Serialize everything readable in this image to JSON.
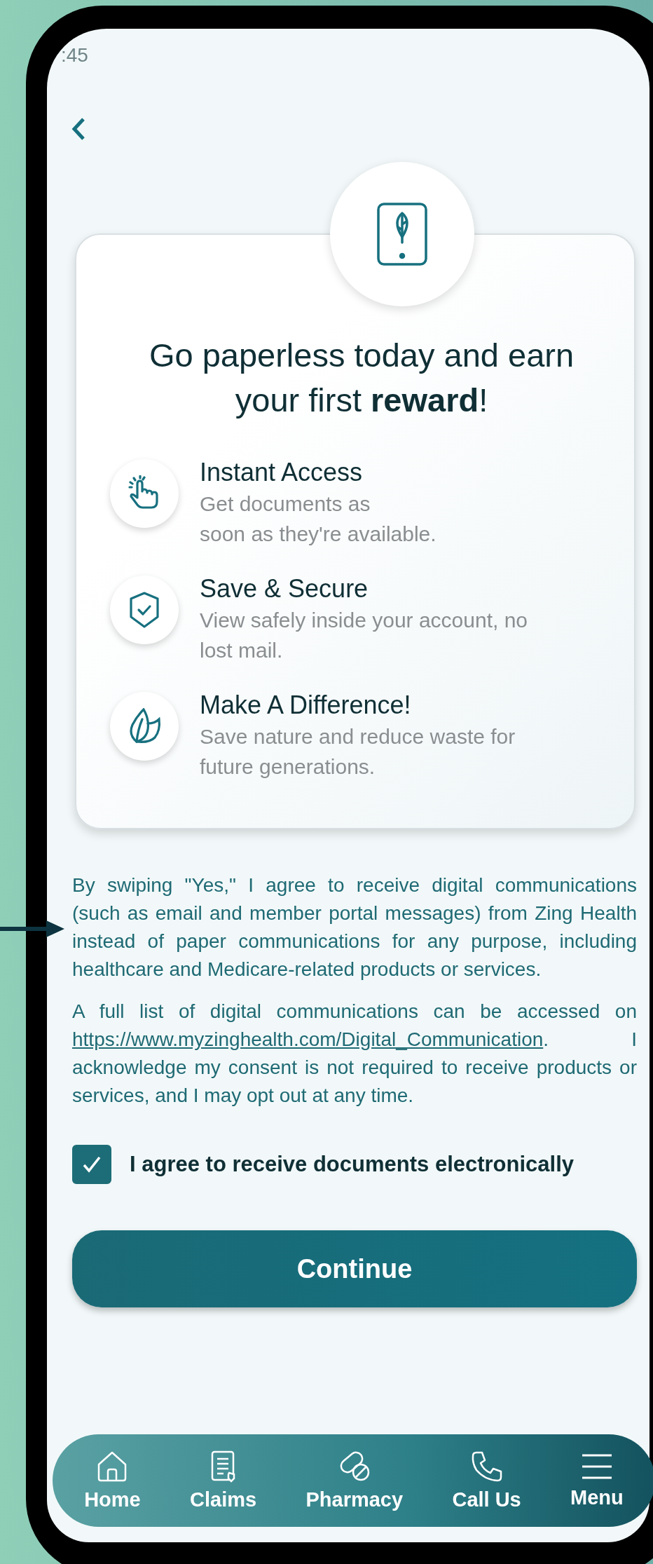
{
  "status_bar": {
    "time": ":45"
  },
  "hero": {
    "title": "Go paperless today and earn your first **reward**!"
  },
  "features": [
    {
      "kind": "tap",
      "title": "Instant Access",
      "description": "Get documents as\nsoon as they're available."
    },
    {
      "kind": "shield",
      "title": "Save & Secure",
      "description": "View safely inside your account, no lost mail."
    },
    {
      "kind": "leaf",
      "title": "Make A Difference!",
      "description": "Save nature and reduce waste for future generations."
    }
  ],
  "consent": {
    "paragraph": "By swiping \"Yes,\" I agree to receive digital communications (such as email and member portal messages) from Zing Health instead of paper communications for any purpose, including healthcare and Medicare-related products or services.",
    "list_before": "A full list of digital communications can be accessed on ",
    "link": "https://www.myzinghealth.com/Digital_Communication",
    "list_after": ". I acknowledge my consent is not required to receive products or services, and I may opt out at any time."
  },
  "agree": {
    "label": "I agree to receive documents electronically",
    "checked": true
  },
  "continue_button": "Continue",
  "nav": [
    {
      "kind": "home",
      "label": "Home"
    },
    {
      "kind": "claims",
      "label": "Claims"
    },
    {
      "kind": "pharmacy",
      "label": "Pharmacy"
    },
    {
      "kind": "call",
      "label": "Call Us"
    },
    {
      "kind": "menu",
      "label": "Menu"
    }
  ]
}
